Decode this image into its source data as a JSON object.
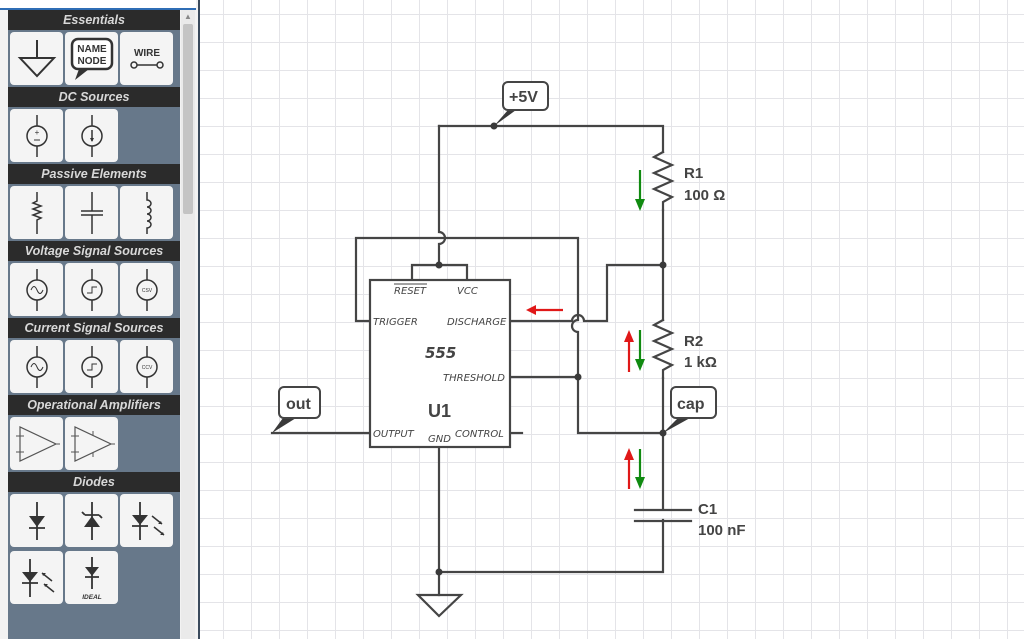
{
  "palette": {
    "categories": [
      {
        "name": "Essentials",
        "items": [
          {
            "icon": "ground-icon"
          },
          {
            "icon": "name-node-icon",
            "text": [
              "NAME",
              "NODE"
            ]
          },
          {
            "icon": "wire-icon",
            "text": "WIRE"
          }
        ]
      },
      {
        "name": "DC Sources",
        "items": [
          {
            "icon": "dc-voltage-source-icon"
          },
          {
            "icon": "dc-current-source-icon"
          }
        ]
      },
      {
        "name": "Passive Elements",
        "items": [
          {
            "icon": "resistor-icon"
          },
          {
            "icon": "capacitor-icon"
          },
          {
            "icon": "inductor-icon"
          }
        ]
      },
      {
        "name": "Voltage Signal Sources",
        "items": [
          {
            "icon": "ac-voltage-source-icon"
          },
          {
            "icon": "square-voltage-source-icon"
          },
          {
            "icon": "controlled-voltage-source-icon",
            "text": "CSV"
          }
        ]
      },
      {
        "name": "Current Signal Sources",
        "items": [
          {
            "icon": "ac-current-source-icon"
          },
          {
            "icon": "square-current-source-icon"
          },
          {
            "icon": "controlled-current-source-icon",
            "text": "CCV"
          }
        ]
      },
      {
        "name": "Operational Amplifiers",
        "items": [
          {
            "icon": "opamp-icon"
          },
          {
            "icon": "opamp-power-icon"
          }
        ]
      },
      {
        "name": "Diodes",
        "items": [
          {
            "icon": "diode-icon"
          },
          {
            "icon": "zener-diode-icon"
          },
          {
            "icon": "led-icon"
          },
          {
            "icon": "photodiode-icon"
          },
          {
            "icon": "ideal-diode-icon",
            "text": "IDEAL"
          }
        ]
      }
    ]
  },
  "schematic": {
    "ic": {
      "name": "U1",
      "type": "555",
      "pins": {
        "reset": "RESET",
        "vcc": "VCC",
        "trigger": "TRIGGER",
        "discharge": "DISCHARGE",
        "threshold": "THRESHOLD",
        "output": "OUTPUT",
        "gnd": "GND",
        "control": "CONTROL"
      }
    },
    "components": [
      {
        "ref": "R1",
        "value": "100 Ω"
      },
      {
        "ref": "R2",
        "value": "1 kΩ"
      },
      {
        "ref": "C1",
        "value": "100 nF"
      }
    ],
    "net_labels": {
      "vcc": "+5V",
      "out": "out",
      "cap": "cap"
    },
    "colors": {
      "wire": "#454545",
      "current_red": "#e01818",
      "current_green": "#108a10"
    }
  }
}
